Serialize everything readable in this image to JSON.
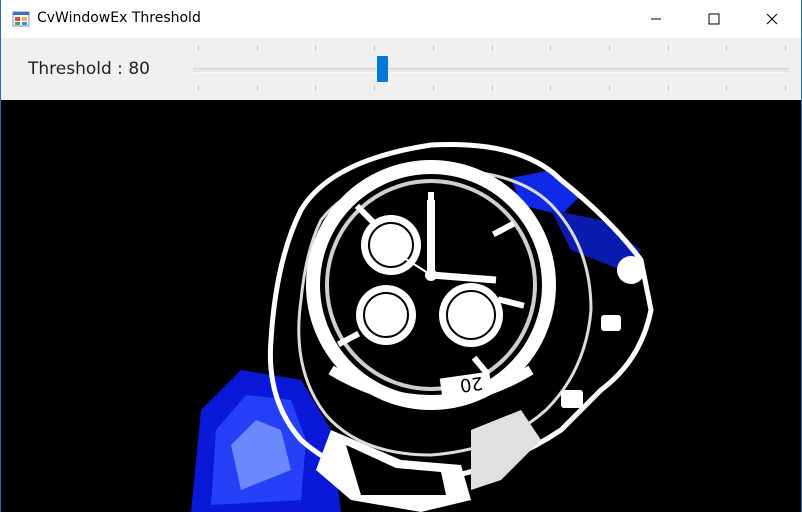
{
  "window": {
    "title": "CvWindowEx Threshold",
    "buttons": {
      "minimize": "minimize-icon",
      "maximize": "maximize-icon",
      "close": "close-icon"
    }
  },
  "toolbar": {
    "threshold_label": "Threshold : 80",
    "slider": {
      "value": 80,
      "min": 0,
      "max": 255,
      "tick_count": 11
    }
  },
  "image": {
    "description_icon": "thresholded-wristwatch-image",
    "colors": {
      "background": "#000000",
      "highlight": "#ffffff",
      "blue_channel": "#1020ff"
    }
  },
  "colors": {
    "accent": "#0078d7",
    "toolbar_bg": "#f0f0f0",
    "border": "#1f6fb5"
  }
}
